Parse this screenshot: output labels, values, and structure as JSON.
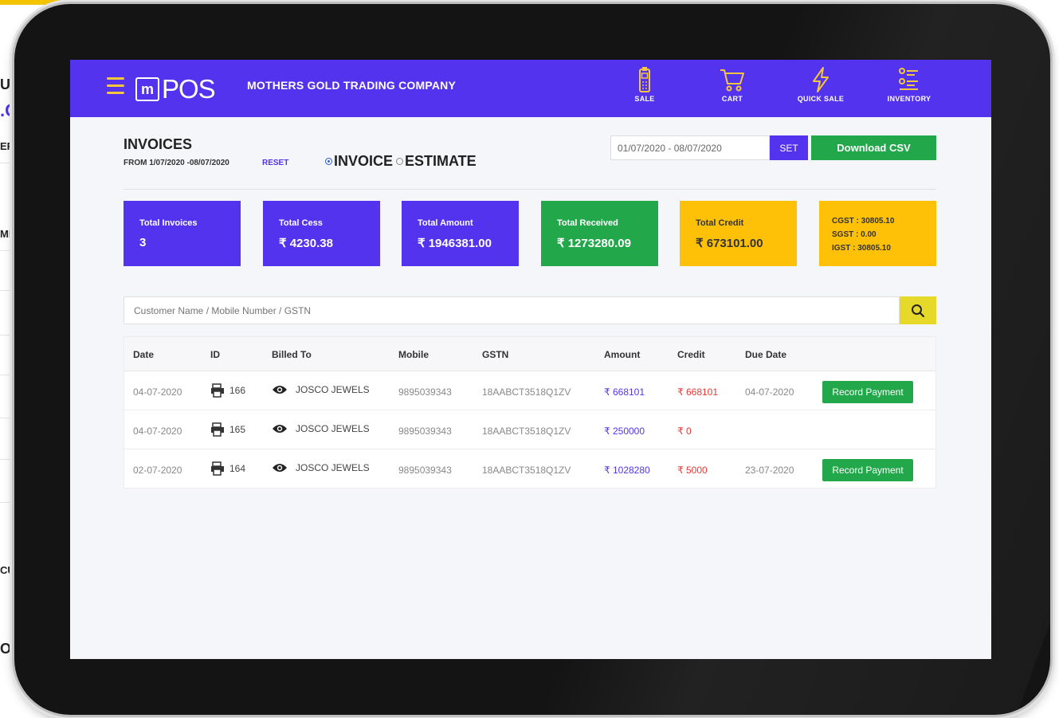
{
  "background": {
    "fragments": [
      "UT",
      ".C",
      "ER",
      "ME",
      "CU",
      "O"
    ]
  },
  "header": {
    "logo_mark": "m",
    "logo_text": "POS",
    "company": "MOTHERS GOLD TRADING COMPANY",
    "nav": [
      {
        "label": "SALE",
        "icon": "mobile-pos-icon"
      },
      {
        "label": "CART",
        "icon": "cart-icon"
      },
      {
        "label": "QUICK SALE",
        "icon": "lightning-icon"
      },
      {
        "label": "INVENTORY",
        "icon": "list-icon"
      }
    ]
  },
  "page": {
    "title": "INVOICES",
    "range": "FROM 1/07/2020 -08/07/2020",
    "reset": "RESET",
    "radio_invoice": "INVOICE",
    "radio_estimate": "ESTIMATE",
    "date_range_value": "01/07/2020 - 08/07/2020",
    "set_label": "SET",
    "csv_label": "Download CSV"
  },
  "cards": [
    {
      "label": "Total Invoices",
      "value": "3",
      "color": "#5333ed"
    },
    {
      "label": "Total Cess",
      "value": "₹ 4230.38",
      "color": "#5333ed"
    },
    {
      "label": "Total Amount",
      "value": "₹ 1946381.00",
      "color": "#5333ed"
    },
    {
      "label": "Total Received",
      "value": "₹ 1273280.09",
      "color": "#22a84a"
    },
    {
      "label": "Total Credit",
      "value": "₹ 673101.00",
      "color": "#ffc107"
    }
  ],
  "tax_card": {
    "cgst": "CGST : 30805.10",
    "sgst": "SGST : 0.00",
    "igst": "IGST : 30805.10",
    "color": "#ffc107"
  },
  "search": {
    "placeholder": "Customer Name / Mobile Number / GSTN"
  },
  "table": {
    "columns": [
      "Date",
      "ID",
      "Billed To",
      "Mobile",
      "GSTN",
      "Amount",
      "Credit",
      "Due Date"
    ],
    "rows": [
      {
        "date": "04-07-2020",
        "id": "166",
        "billed_to": "JOSCO JEWELS",
        "mobile": "9895039343",
        "gstn": "18AABCT3518Q1ZV",
        "amount": "₹ 668101",
        "credit": "₹ 668101",
        "due_date": "04-07-2020",
        "action": "Record Payment"
      },
      {
        "date": "04-07-2020",
        "id": "165",
        "billed_to": "JOSCO JEWELS",
        "mobile": "9895039343",
        "gstn": "18AABCT3518Q1ZV",
        "amount": "₹ 250000",
        "credit": "₹ 0",
        "due_date": "",
        "action": ""
      },
      {
        "date": "02-07-2020",
        "id": "164",
        "billed_to": "JOSCO JEWELS",
        "mobile": "9895039343",
        "gstn": "18AABCT3518Q1ZV",
        "amount": "₹ 1028280",
        "credit": "₹ 5000",
        "due_date": "23-07-2020",
        "action": "Record Payment"
      }
    ]
  },
  "colors": {
    "primary": "#5333ed",
    "success": "#22a84a",
    "warning": "#ffc107",
    "search_button": "#e6d92a",
    "danger": "#e53935"
  }
}
